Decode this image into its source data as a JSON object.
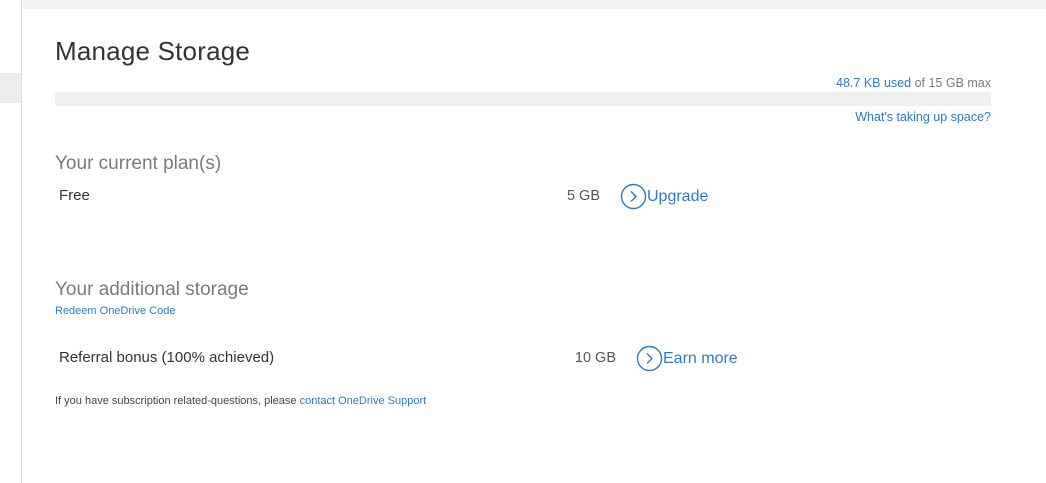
{
  "page": {
    "title": "Manage Storage"
  },
  "usage": {
    "used_text": "48.7 KB used",
    "max_text": " of 15 GB max",
    "used_fraction": 3.1e-06,
    "whats_taking_space": "What's taking up space?"
  },
  "current_plan": {
    "heading": "Your current plan(s)",
    "name": "Free",
    "size": "5 GB",
    "action_label": "Upgrade"
  },
  "additional_storage": {
    "heading": "Your additional storage",
    "redeem_label": "Redeem OneDrive Code",
    "name": "Referral bonus (100% achieved)",
    "size": "10 GB",
    "action_label": "Earn more"
  },
  "footer": {
    "text": "If you have subscription related-questions, please ",
    "link_label": "contact OneDrive Support"
  },
  "colors": {
    "accent": "#2f7bbf",
    "track": "#f0f0f0"
  },
  "icons": {
    "action": "chevron-right-circle-icon"
  }
}
